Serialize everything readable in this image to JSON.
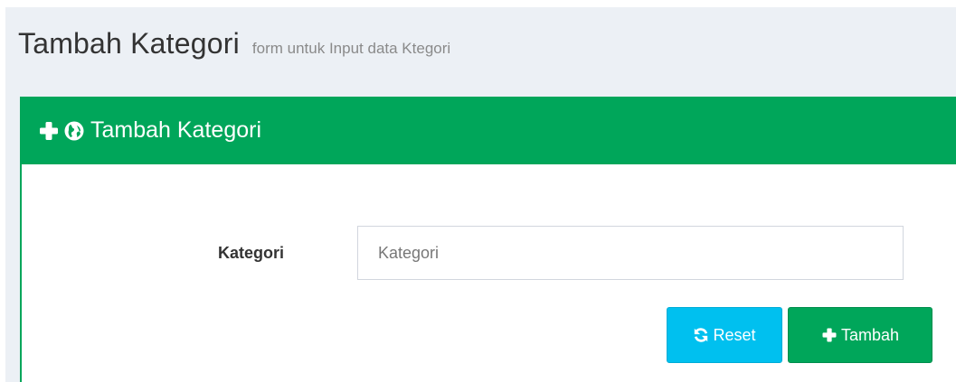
{
  "header": {
    "title": "Tambah Kategori",
    "subtitle": "form untuk Input data Ktegori"
  },
  "box": {
    "title": "Tambah Kategori",
    "icons": [
      "plus-icon",
      "globe-icon"
    ],
    "accent_color": "#00a65a"
  },
  "form": {
    "kategori_label": "Kategori",
    "kategori_placeholder": "Kategori",
    "kategori_value": ""
  },
  "buttons": {
    "reset_label": "Reset",
    "reset_icon": "refresh-icon",
    "reset_color": "#00c0ef",
    "add_label": "Tambah",
    "add_icon": "plus-icon",
    "add_color": "#00a65a"
  }
}
